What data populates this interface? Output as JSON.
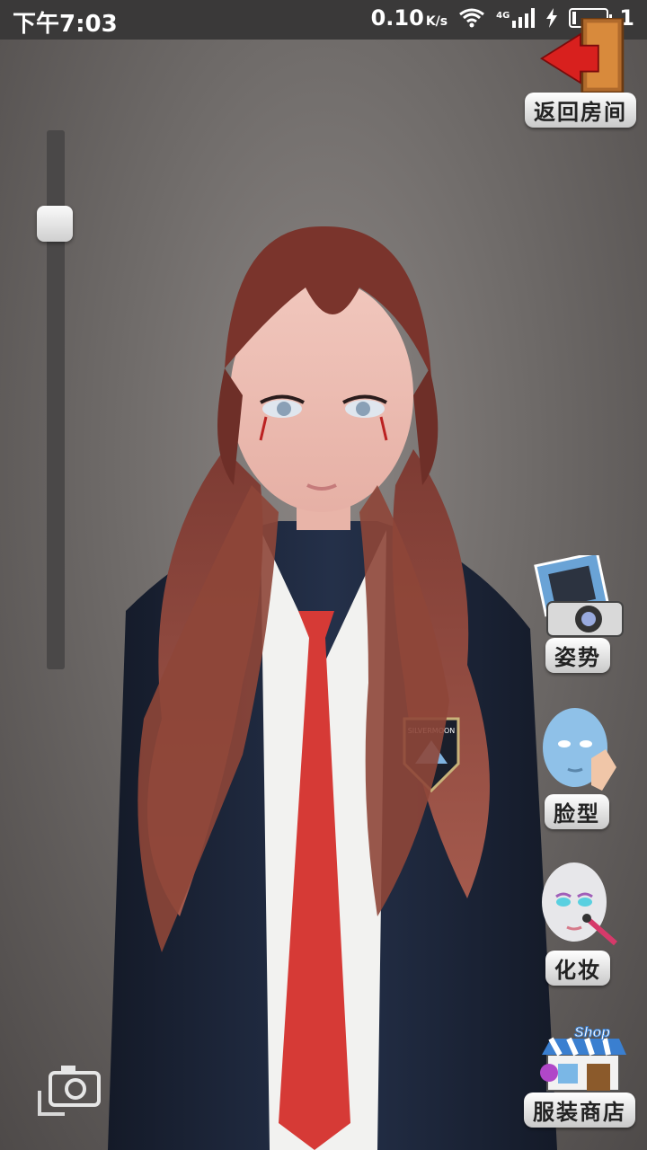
{
  "status_bar": {
    "time": "下午7:03",
    "speed": "0.10",
    "speed_unit": "K/s",
    "network": "4G",
    "battery": "1"
  },
  "zoom_slider": {
    "level_fraction": 0.15
  },
  "buttons": {
    "back": "返回房间",
    "pose": "姿势",
    "face": "脸型",
    "makeup": "化妆",
    "shop": "服装商店"
  },
  "icons": {
    "back": "door-arrow-icon",
    "pose": "camera-photo-icon",
    "face": "face-head-icon",
    "makeup": "makeup-brush-icon",
    "shop": "shop-storefront-icon",
    "screenshot": "camera-icon"
  },
  "badge_text": "SILVERMOON",
  "shop_sign": "Shop",
  "colors": {
    "statusbar": "#3a3939",
    "tie": "#d63a36",
    "hair": "#8a3f35",
    "jacket": "#1d2333"
  }
}
